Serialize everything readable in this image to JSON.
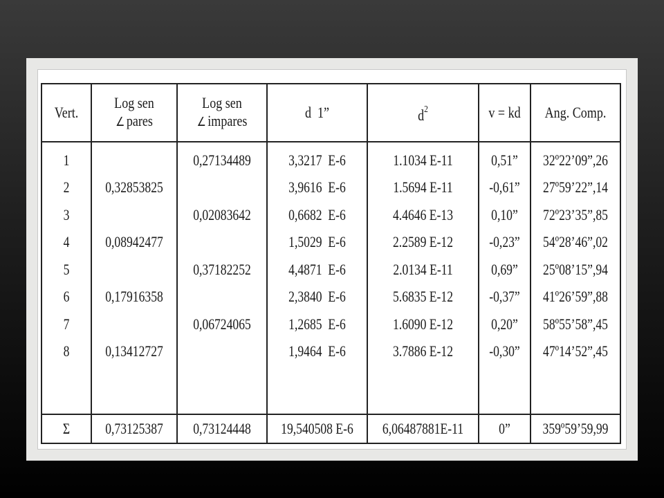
{
  "table": {
    "headers": {
      "vert": "Vert.",
      "log_pares_1": "Log sen",
      "log_pares_2": "pares",
      "log_impares_1": "Log sen",
      "log_impares_2": "impares",
      "d1": "d  1”",
      "d2_base": "d",
      "d2_exp": "2",
      "v": "v = kd",
      "ang": "Ang. Comp."
    },
    "angle_symbol": "∠",
    "rows": [
      {
        "vert": "1",
        "pares": "",
        "impares": "0,27134489",
        "d1": "3,3217  E-6",
        "d2": "1.1034 E-11",
        "v": "0,51”",
        "ang": "32º22’09”,26"
      },
      {
        "vert": "2",
        "pares": "0,32853825",
        "impares": "",
        "d1": "3,9616  E-6",
        "d2": "1.5694 E-11",
        "v": "-0,61”",
        "ang": "27º59’22”,14"
      },
      {
        "vert": "3",
        "pares": "",
        "impares": "0,02083642",
        "d1": "0,6682  E-6",
        "d2": "4.4646 E-13",
        "v": "0,10”",
        "ang": "72º23’35”,85"
      },
      {
        "vert": "4",
        "pares": "0,08942477",
        "impares": "",
        "d1": "1,5029  E-6",
        "d2": "2.2589 E-12",
        "v": "-0,23”",
        "ang": "54º28’46”,02"
      },
      {
        "vert": "5",
        "pares": "",
        "impares": "0,37182252",
        "d1": "4,4871  E-6",
        "d2": "2.0134 E-11",
        "v": "0,69”",
        "ang": "25º08’15”,94"
      },
      {
        "vert": "6",
        "pares": "0,17916358",
        "impares": "",
        "d1": "2,3840  E-6",
        "d2": "5.6835 E-12",
        "v": "-0,37”",
        "ang": "41º26’59”,88"
      },
      {
        "vert": "7",
        "pares": "",
        "impares": "0,06724065",
        "d1": "1,2685  E-6",
        "d2": "1.6090 E-12",
        "v": "0,20”",
        "ang": "58º55’58”,45"
      },
      {
        "vert": "8",
        "pares": "0,13412727",
        "impares": "",
        "d1": "1,9464  E-6",
        "d2": "3.7886 E-12",
        "v": "-0,30”",
        "ang": "47º14’52”,45"
      }
    ],
    "totals": {
      "label": "Σ",
      "pares": "0,73125387",
      "impares": "0,73124448",
      "d1": "19,540508 E-6",
      "d2": "6,06487881E-11",
      "v": "0”",
      "ang": "359º59’59,99"
    }
  }
}
